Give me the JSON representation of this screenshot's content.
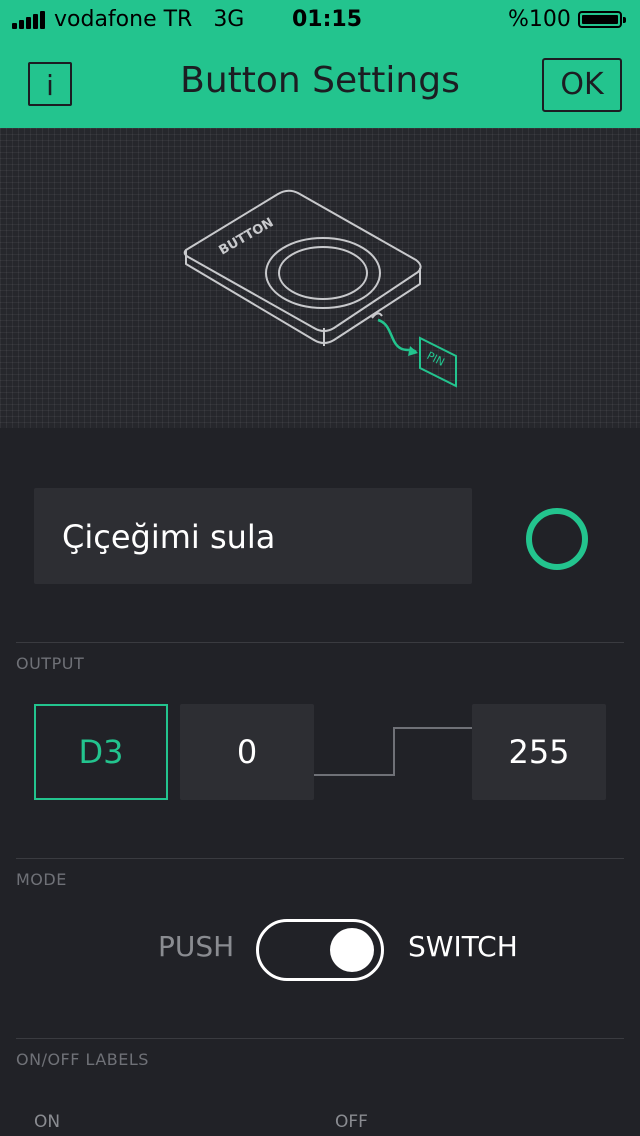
{
  "status_bar": {
    "carrier": "vodafone TR",
    "network": "3G",
    "time": "01:15",
    "battery_percent": "%100"
  },
  "header": {
    "info_label": "i",
    "title": "Button Settings",
    "ok_label": "OK"
  },
  "illustration": {
    "device_label": "BUTTON",
    "pin_label": "PIN"
  },
  "name_field": {
    "value": "Çiçeğimi sula"
  },
  "color_picker": {
    "color": "#23c48e"
  },
  "output": {
    "section_label": "OUTPUT",
    "pin": "D3",
    "low_value": "0",
    "high_value": "255"
  },
  "mode": {
    "section_label": "MODE",
    "push_label": "PUSH",
    "switch_label": "SWITCH",
    "selected": "SWITCH"
  },
  "labels": {
    "section_label": "ON/OFF LABELS",
    "on_label": "ON",
    "off_label": "OFF"
  },
  "colors": {
    "accent": "#23c48e",
    "background": "#212227",
    "field": "#2d2e33"
  }
}
